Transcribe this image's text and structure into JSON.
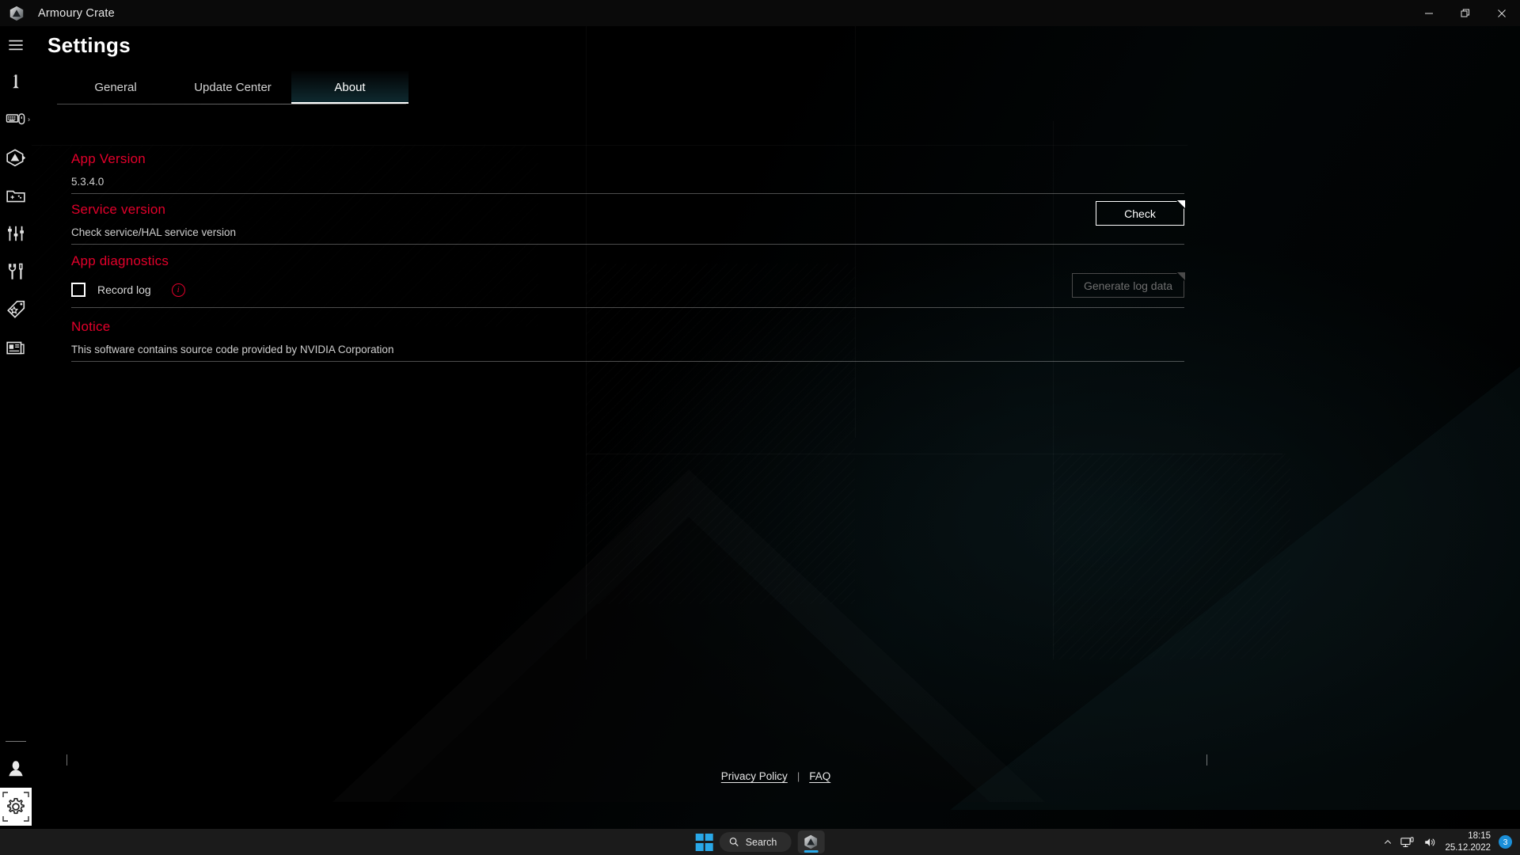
{
  "window": {
    "app_title": "Armoury Crate",
    "logo_icon": "armoury-crate-hexagon-logo",
    "minimize_label": "Minimize",
    "restore_label": "Restore",
    "close_label": "Close"
  },
  "sidebar": {
    "menu_icon": "hamburger-menu-icon",
    "items": [
      {
        "icon": "device-info-icon",
        "label": "Device"
      },
      {
        "icon": "keyboard-mouse-icon",
        "label": "Peripherals",
        "has_chevron": true,
        "chevron": "›"
      },
      {
        "icon": "armoury-crate-logo-icon",
        "label": "Aura Sync"
      },
      {
        "icon": "game-library-icon",
        "label": "Game Library"
      },
      {
        "icon": "sliders-icon",
        "label": "Scenario Profiles"
      },
      {
        "icon": "tools-icon",
        "label": "Tools"
      },
      {
        "icon": "tag-icon",
        "label": "Featured"
      },
      {
        "icon": "news-icon",
        "label": "News"
      }
    ],
    "bottom_items": [
      {
        "icon": "user-account-icon",
        "label": "User Account",
        "active": false
      },
      {
        "icon": "gear-settings-icon",
        "label": "Settings",
        "active": true
      }
    ]
  },
  "page": {
    "title": "Settings"
  },
  "tabs": [
    {
      "label": "General",
      "active": false
    },
    {
      "label": "Update Center",
      "active": false
    },
    {
      "label": "About",
      "active": true
    }
  ],
  "sections": {
    "app_version": {
      "heading": "App Version",
      "value": "5.3.4.0"
    },
    "service_version": {
      "heading": "Service version",
      "value": "Check service/HAL service version",
      "button_label": "Check",
      "button_enabled": true
    },
    "app_diagnostics": {
      "heading": "App diagnostics",
      "checkbox_label": "Record log",
      "checkbox_checked": false,
      "info_icon": "info-circle-icon",
      "info_glyph": "i",
      "button_label": "Generate log data",
      "button_enabled": false
    },
    "notice": {
      "heading": "Notice",
      "text": "This software contains source code provided by NVIDIA Corporation"
    }
  },
  "footer": {
    "privacy_policy": "Privacy Policy",
    "separator": "|",
    "faq": "FAQ"
  },
  "taskbar": {
    "start_icon": "windows-start-icon",
    "search_icon": "search-icon",
    "search_label": "Search",
    "app_icon": "armoury-crate-taskbar-icon",
    "tray": {
      "chevron_icon": "chevron-up-icon",
      "network_icon": "network-display-icon",
      "volume_icon": "volume-icon",
      "time": "18:15",
      "date": "25.12.2022",
      "notification_count": "3"
    }
  },
  "colors": {
    "accent_red": "#e4002b",
    "tab_active_teal": "#143a42",
    "taskbar_blue": "#29a8e8",
    "background": "#000000"
  }
}
